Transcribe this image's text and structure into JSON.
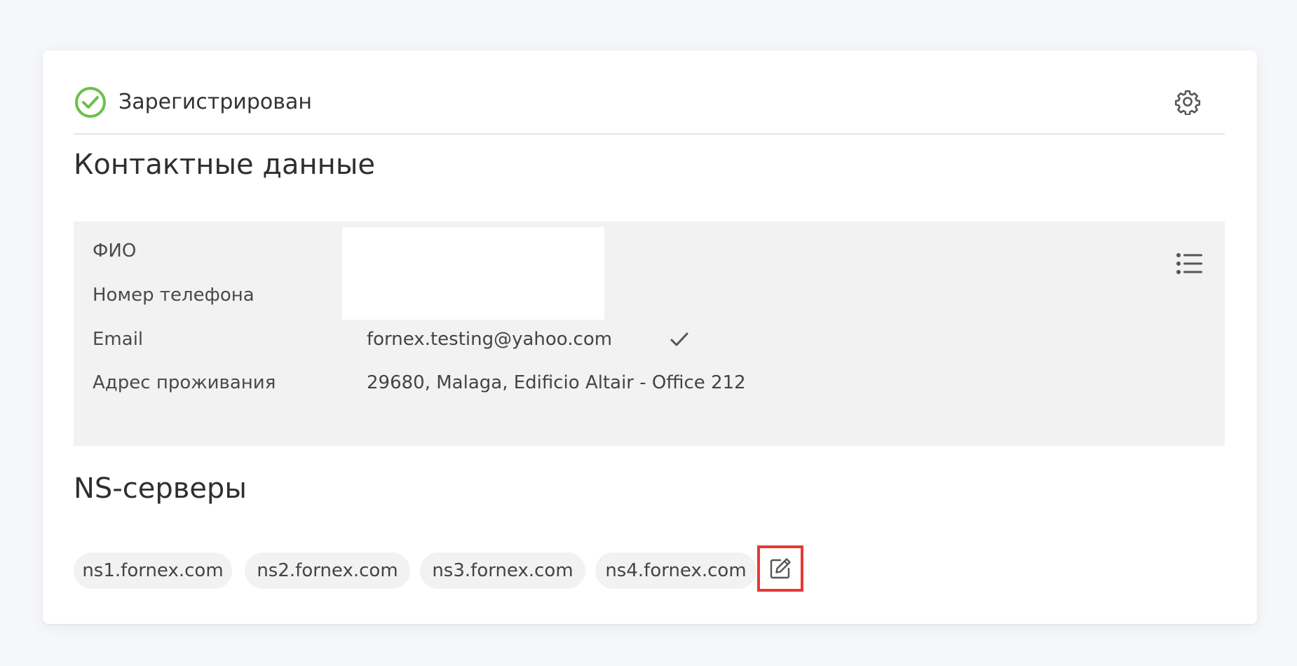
{
  "status": {
    "icon": "check-circle-icon",
    "text": "Зарегистрирован",
    "color": "#6cc04a"
  },
  "settings": {
    "icon": "gear-icon"
  },
  "contacts": {
    "title": "Контактные данные",
    "menu_icon": "list-icon",
    "fields": [
      {
        "label": "ФИО",
        "value": ""
      },
      {
        "label": "Номер телефона",
        "value": ""
      },
      {
        "label": "Email",
        "value": "fornex.testing@yahoo.com",
        "verified_icon": "checkmark-icon"
      },
      {
        "label": "Адрес проживания",
        "value": "29680, Malaga, Edificio Altair - Office 212"
      }
    ]
  },
  "ns": {
    "title": "NS-серверы",
    "servers": [
      "ns1.fornex.com",
      "ns2.fornex.com",
      "ns3.fornex.com",
      "ns4.fornex.com"
    ],
    "edit_icon": "edit-icon",
    "highlight_color": "#e53935"
  }
}
